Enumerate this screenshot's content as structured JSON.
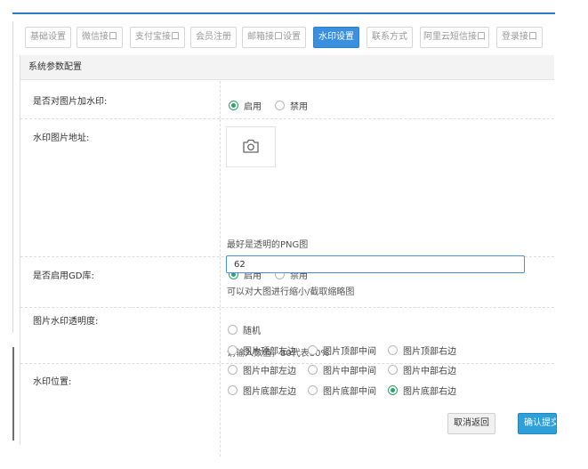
{
  "tabs": [
    {
      "label": "基础设置"
    },
    {
      "label": "微信接口"
    },
    {
      "label": "支付宝接口"
    },
    {
      "label": "会员注册"
    },
    {
      "label": "邮箱接口设置"
    },
    {
      "label": "水印设置"
    },
    {
      "label": "联系方式"
    },
    {
      "label": "阿里云短信接口"
    },
    {
      "label": "登录接口"
    }
  ],
  "active_tab": "水印设置",
  "panel": {
    "title": "系统参数配置"
  },
  "fields": {
    "watermark_enable": {
      "label": "是否对图片加水印:",
      "options": [
        "启用",
        "禁用"
      ],
      "selected": "启用"
    },
    "watermark_image": {
      "label": "水印图片地址:",
      "icon": "camera-icon",
      "hint": "最好是透明的PNG图"
    },
    "gd_enable": {
      "label": "是否启用GD库:",
      "options": [
        "启用",
        "禁用"
      ],
      "selected": "启用",
      "hint": "可以对大图进行缩小/截取缩略图"
    },
    "opacity": {
      "label": "图片水印透明度:",
      "value": "62",
      "hint": "请输入数值，80代表80%"
    },
    "position": {
      "label": "水印位置:",
      "options": [
        "随机",
        "图片顶部左边",
        "图片顶部中间",
        "图片顶部右边",
        "图片中部左边",
        "图片中部中间",
        "图片中部右边",
        "图片底部左边",
        "图片底部中间",
        "图片底部右边"
      ],
      "selected": "图片底部右边"
    }
  },
  "buttons": {
    "cancel": "取消返回",
    "confirm": "确认提交"
  },
  "colors": {
    "accent": "#3a8fde",
    "radio_checked": "#2fa36b",
    "confirm_button": "#2e9fd8"
  }
}
